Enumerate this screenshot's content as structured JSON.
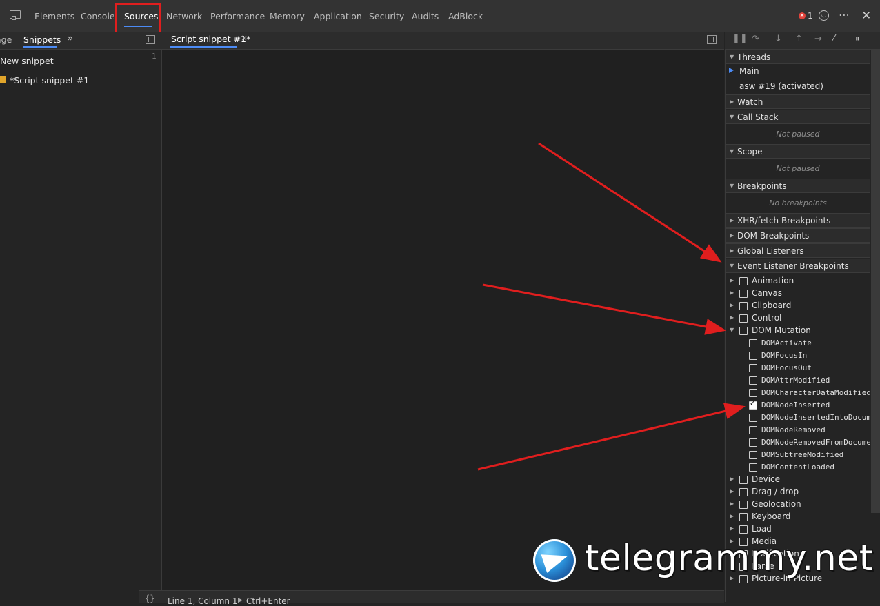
{
  "toolbar": {
    "tabs": [
      "Elements",
      "Console",
      "Sources",
      "Network",
      "Performance",
      "Memory",
      "Application",
      "Security",
      "Audits",
      "AdBlock"
    ],
    "active_tab": "Sources",
    "error_count": "1",
    "more_label": "⋯",
    "close_label": "✕"
  },
  "navigator": {
    "tabs": [
      "age",
      "Snippets"
    ],
    "more_label": "»",
    "new_snippet": "New snippet",
    "snippet_file": "*Script snippet #1"
  },
  "editor": {
    "tab_label": "Script snippet #1*",
    "tab_close": "×",
    "line_number": "1",
    "status_position": "Line 1, Column 1",
    "status_run": "Ctrl+Enter",
    "format_label": "{}"
  },
  "debugger": {
    "threads_header": "Threads",
    "threads": [
      "Main",
      "asw #19 (activated)"
    ],
    "watch": "Watch",
    "call_stack": "Call Stack",
    "call_stack_empty": "Not paused",
    "scope": "Scope",
    "scope_empty": "Not paused",
    "breakpoints": "Breakpoints",
    "breakpoints_empty": "No breakpoints",
    "xhr": "XHR/fetch Breakpoints",
    "dom": "DOM Breakpoints",
    "global": "Global Listeners",
    "event_listener": "Event Listener Breakpoints",
    "categories_top": [
      "Animation",
      "Canvas",
      "Clipboard",
      "Control"
    ],
    "dom_mutation": "DOM Mutation",
    "dom_events": [
      {
        "label": "DOMActivate",
        "checked": false
      },
      {
        "label": "DOMFocusIn",
        "checked": false
      },
      {
        "label": "DOMFocusOut",
        "checked": false
      },
      {
        "label": "DOMAttrModified",
        "checked": false
      },
      {
        "label": "DOMCharacterDataModified",
        "checked": false
      },
      {
        "label": "DOMNodeInserted",
        "checked": true
      },
      {
        "label": "DOMNodeInsertedIntoDocument",
        "checked": false
      },
      {
        "label": "DOMNodeRemoved",
        "checked": false
      },
      {
        "label": "DOMNodeRemovedFromDocument",
        "checked": false
      },
      {
        "label": "DOMSubtreeModified",
        "checked": false
      },
      {
        "label": "DOMContentLoaded",
        "checked": false
      }
    ],
    "categories_bottom": [
      "Device",
      "Drag / drop",
      "Geolocation",
      "Keyboard",
      "Load",
      "Media",
      "Notification",
      "Parse",
      "Picture-in-Picture"
    ]
  },
  "watermark": {
    "text": "telegrammy.net"
  },
  "colors": {
    "accent": "#4c8bf5",
    "annotation": "#e01e1e"
  }
}
